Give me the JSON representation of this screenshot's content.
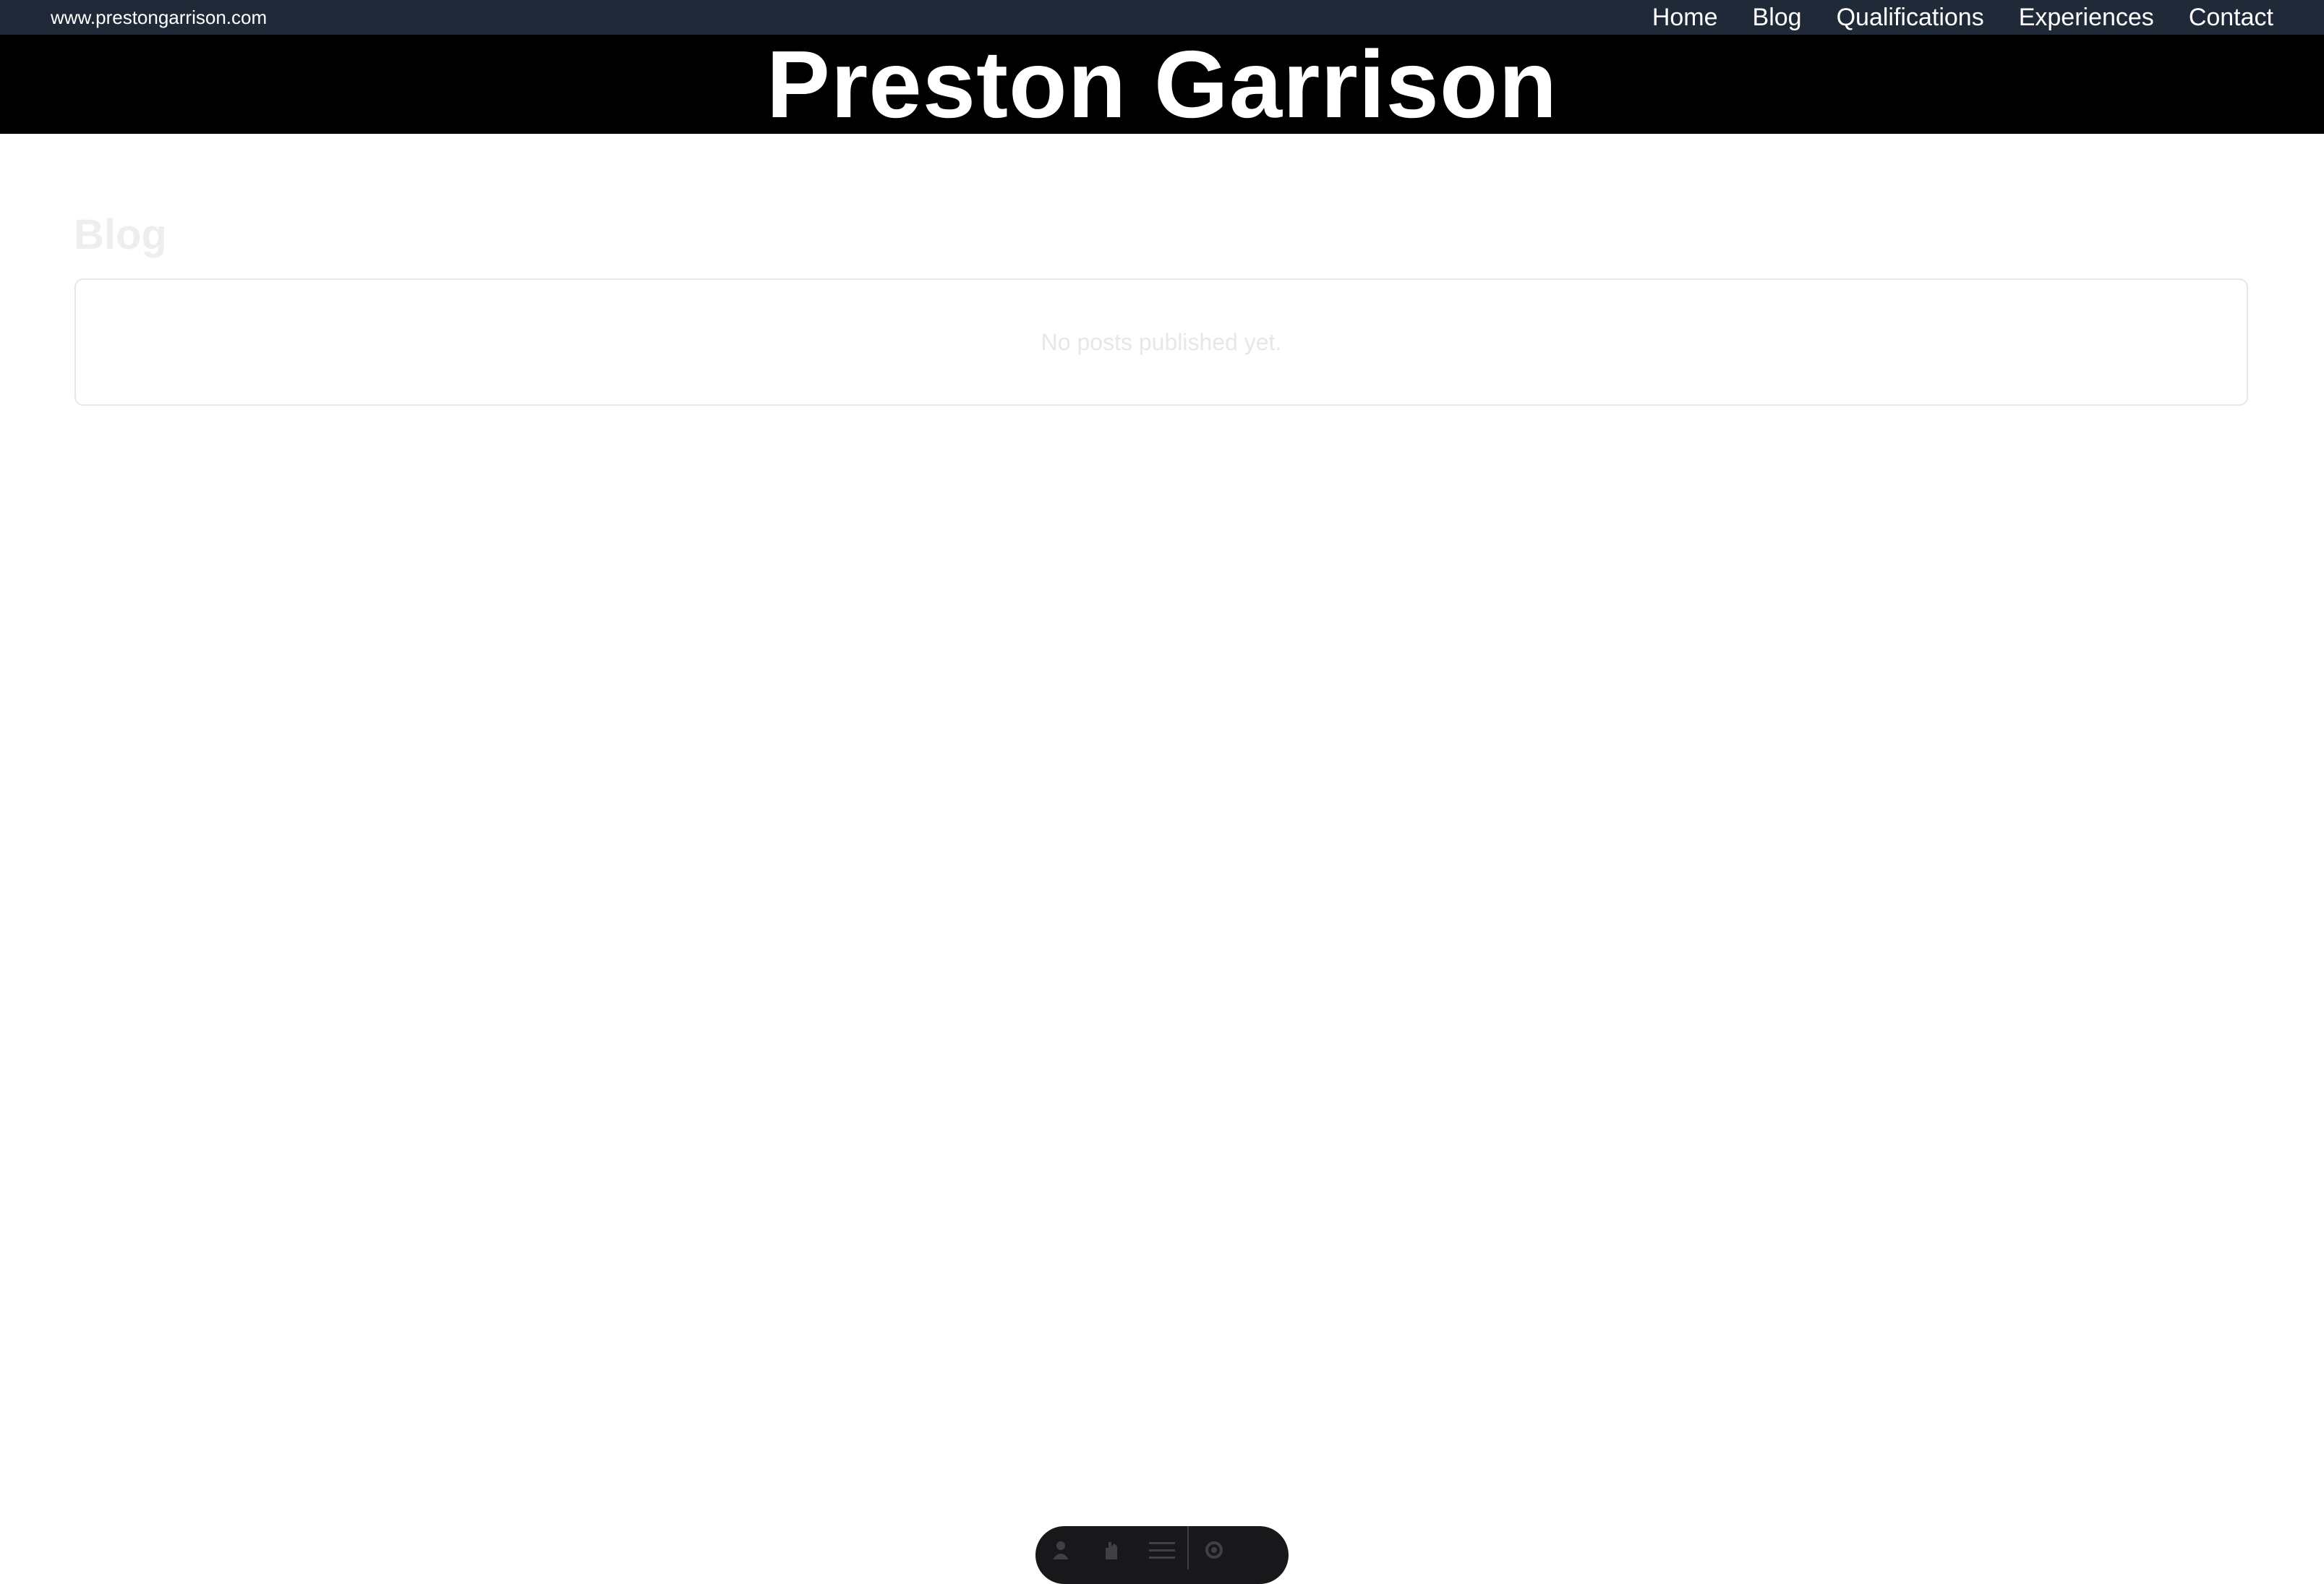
{
  "header": {
    "site_url": "www.prestongarrison.com",
    "nav": [
      {
        "label": "Home"
      },
      {
        "label": "Blog"
      },
      {
        "label": "Qualifications"
      },
      {
        "label": "Experiences"
      },
      {
        "label": "Contact"
      }
    ]
  },
  "banner": {
    "title": "Preston Garrison"
  },
  "main": {
    "heading": "Blog",
    "empty_message": "No posts published yet."
  },
  "toolbar": {
    "icons": [
      "person-icon",
      "hand-icon",
      "menu-icon",
      "gear-icon"
    ]
  },
  "colors": {
    "topbar_bg": "#1f2937",
    "banner_bg": "#000000",
    "toolbar_bg": "#18181b"
  }
}
